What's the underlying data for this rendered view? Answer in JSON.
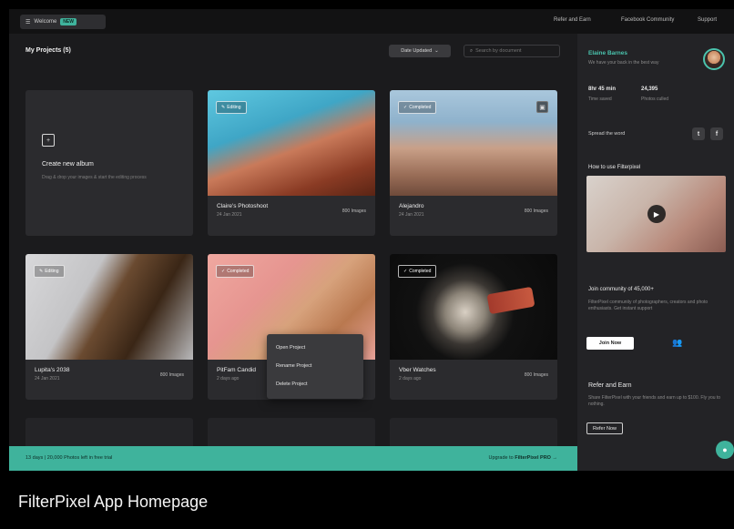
{
  "topbar": {
    "workspace_label": "Welcome",
    "workspace_badge": "NEW",
    "links": [
      "Refer and Earn",
      "Facebook Community",
      "Support"
    ]
  },
  "main": {
    "title": "My Projects (5)",
    "sort_label": "Date Updated",
    "search_placeholder": "Search by document",
    "create": {
      "title": "Create new album",
      "description": "Drag & drop your images & start the editing process"
    },
    "cards": [
      {
        "status": "Editing",
        "name": "Claire's Photoshoot",
        "date": "24 Jan 2021",
        "count": "800 Images"
      },
      {
        "status": "Completed",
        "name": "Alejandro",
        "date": "24 Jan 2021",
        "count": "800 Images"
      },
      {
        "status": "Editing",
        "name": "Lupita's 2038",
        "date": "24 Jan 2021",
        "count": "800 Images"
      },
      {
        "status": "Completed",
        "name": "PitFam Candid",
        "date": "2 days ago",
        "count": ""
      },
      {
        "status": "Completed",
        "name": "Vber Watches",
        "date": "2 days ago",
        "count": "800 Images"
      }
    ],
    "context_menu": [
      "Open Project",
      "Rename Project",
      "Delete Project"
    ],
    "banner": {
      "left": "13 days | 20,000 Photos left in free trial",
      "right_prefix": "Upgrade to ",
      "right_brand": "FilterPixel PRO",
      "right_arrow": "→"
    }
  },
  "sidebar": {
    "user_name": "Elaine Barnes",
    "user_sub": "We have your back in the best way",
    "stats": [
      {
        "value": "8hr 45 min",
        "label": "Time saved"
      },
      {
        "value": "24,395",
        "label": "Photos culled"
      }
    ],
    "spread_label": "Spread the word",
    "how_to_title": "How to use Filterpixel",
    "community_title": "Join community of 45,000+",
    "community_desc": "FilterPixel community of photographers, creators and photo enthusiasts. Get instant support",
    "join_label": "Join Now",
    "refer_title": "Refer and Earn",
    "refer_desc": "Share FilterPixel with your friends and earn up to $100. Fly you to nothing.",
    "refer_button": "Refer Now"
  },
  "caption": "FilterPixel App Homepage",
  "colors": {
    "accent": "#3fb39c",
    "background": "#1b1b1d",
    "card": "#2b2b2e"
  }
}
